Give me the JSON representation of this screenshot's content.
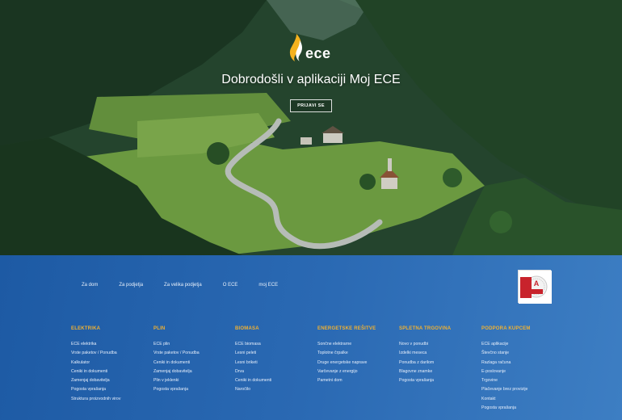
{
  "hero": {
    "logo_text": "ece",
    "welcome": "Dobrodošli v aplikaciji Moj ECE",
    "login_label": "PRIJAVI SE"
  },
  "top_nav": [
    "Za dom",
    "Za podjetja",
    "Za velika podjetja",
    "O ECE",
    "moj ECE"
  ],
  "badge": {
    "brand": "Excellent SME",
    "year": "2020"
  },
  "columns": [
    {
      "title": "ELEKTRIKA",
      "items": [
        "ECE elektrika",
        "Vrste paketov / Ponudba",
        "Kalkulator",
        "Ceniki in dokumenti",
        "Zamenjaj dobavitelja",
        "Pogosta vprašanja",
        "Struktura proizvodnih virov"
      ]
    },
    {
      "title": "PLIN",
      "items": [
        "ECE plin",
        "Vrste paketov / Ponudba",
        "Ceniki in dokumenti",
        "Zamenjaj dobavitelja",
        "Plin v jeklenki",
        "Pogosta vprašanja"
      ]
    },
    {
      "title": "BIOMASA",
      "items": [
        "ECE biomasa",
        "Lesni peleti",
        "Lesni briketi",
        "Drva",
        "Ceniki in dokumenti",
        "Naročilo"
      ]
    },
    {
      "title": "ENERGETSKE REŠITVE",
      "items": [
        "Sončne elektrarne",
        "Toplotne črpalke",
        "Druge energetske naprave",
        "Varčevanje z energijo",
        "Pametni dom"
      ]
    },
    {
      "title": "SPLETNA TRGOVINA",
      "items": [
        "Novo v ponudbi",
        "Izdelki meseca",
        "Ponudba z darilom",
        "Blagovne znamke",
        "Pogosta vprašanja"
      ]
    },
    {
      "title": "PODPORA KUPCEM",
      "items": [
        "ECE aplikacije",
        "Števčno stanje",
        "Razlaga računa",
        "E-poslovanje",
        "Trgovine",
        "Plačevanje brez provizije",
        "Kontakt",
        "Pogosta vprašanja"
      ]
    }
  ],
  "colors": {
    "accent": "#f0b132",
    "footer_bg": "#2a69b3"
  }
}
